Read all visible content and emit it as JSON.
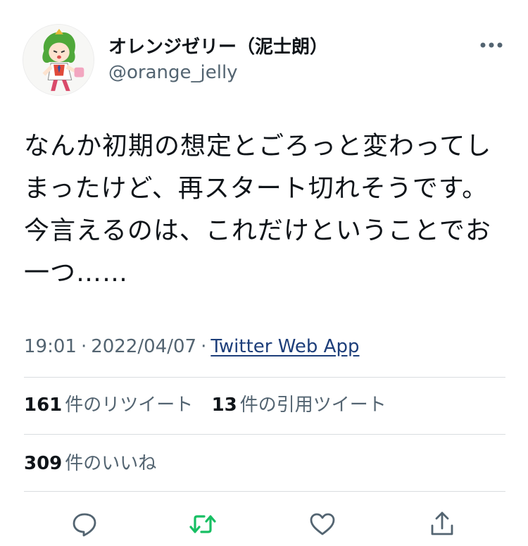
{
  "user": {
    "display_name": "オレンジゼリー（泥士朗）",
    "handle": "@orange_jelly"
  },
  "tweet": {
    "text": "なんか初期の想定とごろっと変わってしまったけど、再スタート切れそうです。今言えるのは、これだけということでお一つ……",
    "time": "19:01",
    "date": "2022/04/07",
    "separator": "·",
    "source": "Twitter Web App"
  },
  "stats": {
    "retweets_count": "161",
    "retweets_label": "件のリツイート",
    "quotes_count": "13",
    "quotes_label": "件の引用ツイート",
    "likes_count": "309",
    "likes_label": "件のいいね"
  },
  "icons": {
    "more": "more-horizontal-icon",
    "reply": "reply-icon",
    "retweet": "retweet-icon",
    "like": "heart-icon",
    "share": "share-icon"
  },
  "colors": {
    "text": "#0f1419",
    "secondary": "#536471",
    "link": "#1d3e7a",
    "retweet_green": "#17bf63",
    "icon_gray": "#536471"
  }
}
